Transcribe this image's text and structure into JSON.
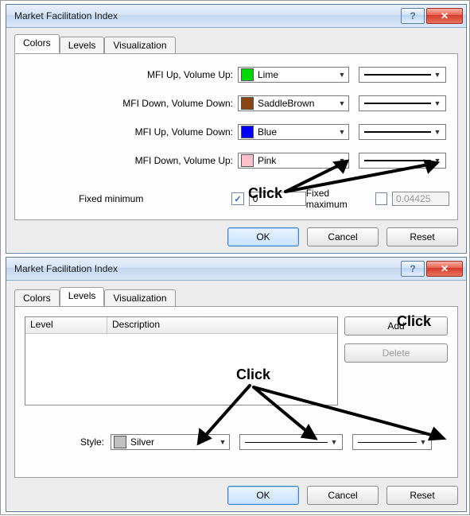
{
  "dialog1": {
    "title": "Market Facilitation Index",
    "tabs": [
      "Colors",
      "Levels",
      "Visualization"
    ],
    "active_tab": 0,
    "rows": [
      {
        "label": "MFI Up, Volume Up:",
        "color_name": "Lime",
        "swatch": "#00d900"
      },
      {
        "label": "MFI Down, Volume Down:",
        "color_name": "SaddleBrown",
        "swatch": "#8b4513"
      },
      {
        "label": "MFI Up, Volume Down:",
        "color_name": "Blue",
        "swatch": "#0000ff"
      },
      {
        "label": "MFI Down, Volume Up:",
        "color_name": "Pink",
        "swatch": "#ffc0cb"
      }
    ],
    "fixed_min_label": "Fixed minimum",
    "fixed_min_checked": true,
    "fixed_min_value": "0",
    "fixed_max_label": "Fixed maximum",
    "fixed_max_checked": false,
    "fixed_max_value": "0.04425",
    "buttons": {
      "ok": "OK",
      "cancel": "Cancel",
      "reset": "Reset"
    }
  },
  "dialog2": {
    "title": "Market Facilitation Index",
    "tabs": [
      "Colors",
      "Levels",
      "Visualization"
    ],
    "active_tab": 1,
    "headers": {
      "level": "Level",
      "description": "Description"
    },
    "add_label": "Add",
    "delete_label": "Delete",
    "style_label": "Style:",
    "style_color": "Silver",
    "style_swatch": "#c0c0c0",
    "buttons": {
      "ok": "OK",
      "cancel": "Cancel",
      "reset": "Reset"
    }
  },
  "annotations": {
    "click": "Click"
  }
}
